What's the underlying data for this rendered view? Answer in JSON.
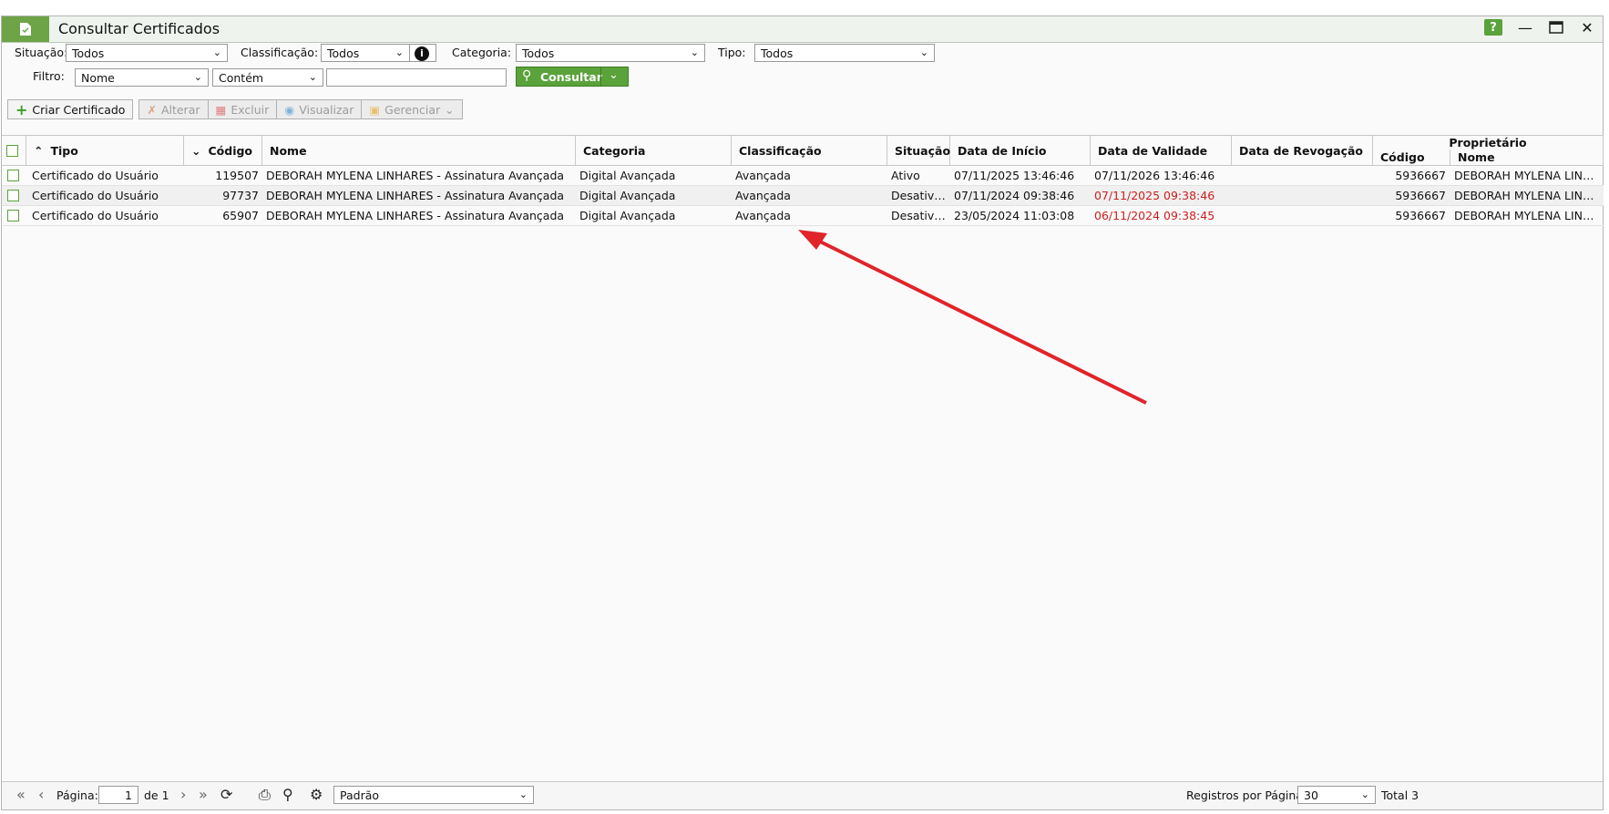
{
  "window": {
    "title": "Consultar Certificados"
  },
  "filters": {
    "situacao_label": "Situação:",
    "situacao_value": "Todos",
    "classificacao_label": "Classificação:",
    "classificacao_value": "Todos",
    "categoria_label": "Categoria:",
    "categoria_value": "Todos",
    "tipo_label": "Tipo:",
    "tipo_value": "Todos",
    "filtro_label": "Filtro:",
    "filtro_field": "Nome",
    "filtro_op": "Contém",
    "filtro_text": "",
    "consultar_label": "Consultar"
  },
  "toolbar": {
    "criar": "Criar Certificado",
    "alterar": "Alterar",
    "excluir": "Excluir",
    "visualizar": "Visualizar",
    "gerenciar": "Gerenciar"
  },
  "grid": {
    "headers": {
      "tipo": "Tipo",
      "codigo": "Código",
      "nome": "Nome",
      "categoria": "Categoria",
      "classificacao": "Classificação",
      "situacao": "Situação",
      "data_inicio": "Data de Início",
      "data_validade": "Data de Validade",
      "data_revogacao": "Data de Revogação",
      "proprietario": "Proprietário",
      "prop_codigo": "Código",
      "prop_nome": "Nome"
    },
    "rows": [
      {
        "tipo": "Certificado do Usuário",
        "codigo": "119507",
        "nome": "DEBORAH MYLENA LINHARES - Assinatura Avançada",
        "categoria": "Digital Avançada",
        "classificacao": "Avançada",
        "situacao": "Ativo",
        "data_inicio": "07/11/2025 13:46:46",
        "data_validade": "07/11/2026 13:46:46",
        "data_revogacao": "",
        "prop_codigo": "5936667",
        "prop_nome": "DEBORAH MYLENA LINHARES"
      },
      {
        "tipo": "Certificado do Usuário",
        "codigo": "97737",
        "nome": "DEBORAH MYLENA LINHARES - Assinatura Avançada",
        "categoria": "Digital Avançada",
        "classificacao": "Avançada",
        "situacao": "Desativado",
        "data_inicio": "07/11/2024 09:38:46",
        "data_validade": "07/11/2025 09:38:46",
        "data_revogacao": "",
        "prop_codigo": "5936667",
        "prop_nome": "DEBORAH MYLENA LINHARES"
      },
      {
        "tipo": "Certificado do Usuário",
        "codigo": "65907",
        "nome": "DEBORAH MYLENA LINHARES - Assinatura Avançada",
        "categoria": "Digital Avançada",
        "classificacao": "Avançada",
        "situacao": "Desativado",
        "data_inicio": "23/05/2024 11:03:08",
        "data_validade": "06/11/2024 09:38:45",
        "data_revogacao": "",
        "prop_codigo": "5936667",
        "prop_nome": "DEBORAH MYLENA LINHARES"
      }
    ]
  },
  "footer": {
    "pagina_label": "Página:",
    "pagina_value": "1",
    "de_label": "de 1",
    "layout_value": "Padrão",
    "registros_label": "Registros por Página:",
    "registros_value": "30",
    "total_label": "Total 3"
  },
  "colors": {
    "accent": "#5aa23a",
    "expired": "#cc1f1f",
    "annotation_arrow": "#e0242a"
  }
}
